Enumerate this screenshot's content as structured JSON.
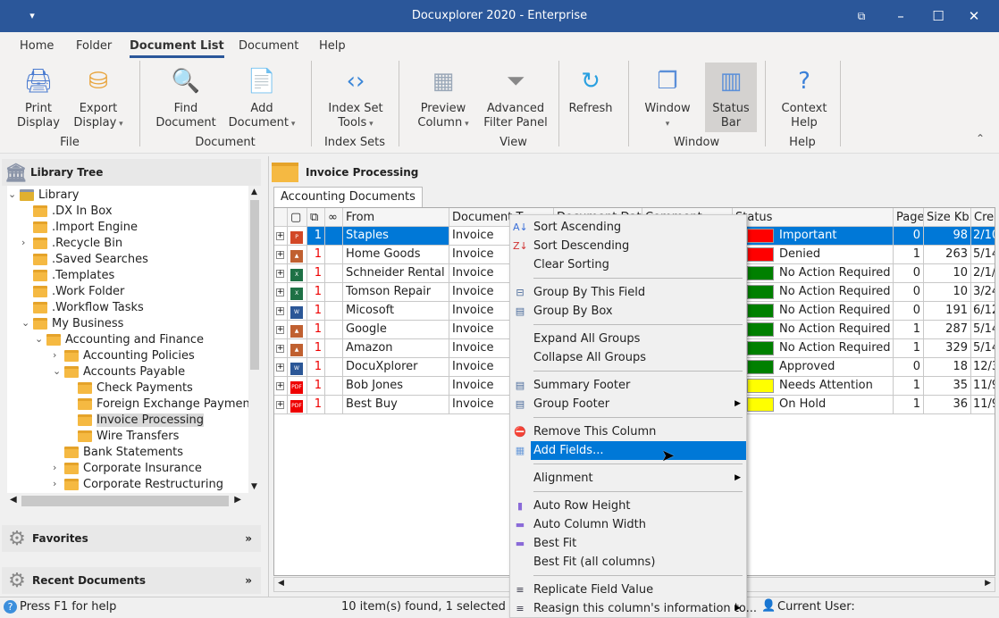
{
  "window": {
    "title": "Docuxplorer 2020 - Enterprise",
    "controls": [
      "restore-panel",
      "minimize",
      "maximize",
      "close"
    ]
  },
  "ribbon": {
    "tabs": [
      "Home",
      "Folder",
      "Document List",
      "Document",
      "Help"
    ],
    "active_tab": "Document List",
    "buttons": [
      {
        "l1": "Print",
        "l2": "Display",
        "icon": "printer-icon"
      },
      {
        "l1": "Export",
        "l2": "Display",
        "icon": "export-database-icon",
        "dropdown": true
      },
      {
        "l1": "Find",
        "l2": "Document",
        "icon": "magnifier-icon"
      },
      {
        "l1": "Add",
        "l2": "Document",
        "icon": "add-document-icon",
        "dropdown": true
      },
      {
        "l1": "Index Set",
        "l2": "Tools",
        "icon": "code-icon",
        "dropdown": true
      },
      {
        "l1": "Preview",
        "l2": "Column",
        "icon": "table-icon",
        "dropdown": true
      },
      {
        "l1": "Advanced",
        "l2": "Filter Panel",
        "icon": "funnel-icon"
      },
      {
        "l1": "Refresh",
        "l2": "",
        "icon": "refresh-icon"
      },
      {
        "l1": "Window",
        "l2": "",
        "icon": "windows-icon",
        "dropdown": true
      },
      {
        "l1": "Status",
        "l2": "Bar",
        "icon": "status-bar-icon",
        "pressed": true
      },
      {
        "l1": "Context",
        "l2": "Help",
        "icon": "help-icon"
      }
    ],
    "groups": [
      "File",
      "Document",
      "Index Sets",
      "View",
      "Window",
      "Help"
    ]
  },
  "left": {
    "library_tree_title": "Library Tree",
    "tree": [
      {
        "label": "Library",
        "level": 0,
        "expanded": true
      },
      {
        "label": ".DX In Box",
        "level": 1
      },
      {
        "label": ".Import Engine",
        "level": 1
      },
      {
        "label": ".Recycle Bin",
        "level": 1,
        "collapsed": true
      },
      {
        "label": ".Saved Searches",
        "level": 1
      },
      {
        "label": ".Templates",
        "level": 1
      },
      {
        "label": ".Work Folder",
        "level": 1
      },
      {
        "label": ".Workflow Tasks",
        "level": 1
      },
      {
        "label": "My Business",
        "level": 1,
        "expanded": true
      },
      {
        "label": "Accounting and Finance",
        "level": 2,
        "expanded": true
      },
      {
        "label": "Accounting Policies",
        "level": 3,
        "collapsed": true
      },
      {
        "label": "Accounts Payable",
        "level": 3,
        "expanded": true
      },
      {
        "label": "Check Payments",
        "level": 4
      },
      {
        "label": "Foreign Exchange Payment",
        "level": 4
      },
      {
        "label": "Invoice Processing",
        "level": 4,
        "selected": true
      },
      {
        "label": "Wire Transfers",
        "level": 4
      },
      {
        "label": "Bank Statements",
        "level": 3
      },
      {
        "label": "Corporate Insurance",
        "level": 3,
        "collapsed": true
      },
      {
        "label": "Corporate Restructuring",
        "level": 3,
        "collapsed": true
      }
    ],
    "favorites": "Favorites",
    "recent": "Recent Documents"
  },
  "main": {
    "folder_title": "Invoice Processing",
    "tab": "Accounting Documents",
    "columns": [
      "From",
      "Document T",
      "Document Dat",
      "Comment",
      "Status",
      "Page",
      "Size Kb",
      "Crea"
    ],
    "rows": [
      {
        "icon": "powerpoint",
        "count": "1",
        "from": "Staples",
        "type": "Invoice",
        "status": "Important",
        "color": "#ff0000",
        "pages": "0",
        "size": "98",
        "created": "2/10",
        "selected": true
      },
      {
        "icon": "image",
        "count": "1",
        "from": "Home Goods",
        "type": "Invoice",
        "status": "Denied",
        "color": "#ff0000",
        "pages": "1",
        "size": "263",
        "created": "5/14"
      },
      {
        "icon": "excel",
        "count": "1",
        "from": "Schneider Rental",
        "type": "Invoice",
        "status": "No Action Required",
        "color": "#008000",
        "pages": "0",
        "size": "10",
        "created": "2/1/"
      },
      {
        "icon": "excel",
        "count": "1",
        "from": "Tomson Repair",
        "type": "Invoice",
        "status": "No Action Required",
        "color": "#008000",
        "pages": "0",
        "size": "10",
        "created": "3/24"
      },
      {
        "icon": "word",
        "count": "1",
        "from": "Micosoft",
        "type": "Invoice",
        "status": "No Action Required",
        "color": "#008000",
        "pages": "0",
        "size": "191",
        "created": "6/12"
      },
      {
        "icon": "image",
        "count": "1",
        "from": "Google",
        "type": "Invoice",
        "status": "No Action Required",
        "color": "#008000",
        "pages": "1",
        "size": "287",
        "created": "5/14"
      },
      {
        "icon": "image",
        "count": "1",
        "from": "Amazon",
        "type": "Invoice",
        "status": "No Action Required",
        "color": "#008000",
        "pages": "1",
        "size": "329",
        "created": "5/14"
      },
      {
        "icon": "word",
        "count": "1",
        "from": "DocuXplorer",
        "type": "Invoice",
        "status": "Approved",
        "color": "#008000",
        "pages": "0",
        "size": "18",
        "created": "12/3"
      },
      {
        "icon": "pdf",
        "count": "1",
        "from": "Bob Jones",
        "type": "Invoice",
        "status": "Needs Attention",
        "color": "#ffff00",
        "pages": "1",
        "size": "35",
        "created": "11/9"
      },
      {
        "icon": "pdf",
        "count": "1",
        "from": "Best Buy",
        "type": "Invoice",
        "status": "On Hold",
        "color": "#ffff00",
        "pages": "1",
        "size": "36",
        "created": "11/9"
      }
    ]
  },
  "context_menu": [
    {
      "label": "Sort Ascending",
      "icon": "sort-ascending-icon"
    },
    {
      "label": "Sort Descending",
      "icon": "sort-descending-icon"
    },
    {
      "label": "Clear Sorting"
    },
    {
      "sep": true
    },
    {
      "label": "Group By This Field",
      "icon": "group-by-field-icon"
    },
    {
      "label": "Group By Box",
      "icon": "group-by-box-icon"
    },
    {
      "sep": true
    },
    {
      "label": "Expand All Groups"
    },
    {
      "label": "Collapse All Groups"
    },
    {
      "sep": true
    },
    {
      "label": "Summary Footer",
      "icon": "summary-footer-icon"
    },
    {
      "label": "Group Footer",
      "icon": "group-footer-icon",
      "submenu": true
    },
    {
      "sep": true
    },
    {
      "label": "Remove This Column",
      "icon": "remove-icon"
    },
    {
      "label": "Add Fields...",
      "icon": "add-fields-icon",
      "highlighted": true
    },
    {
      "sep": true
    },
    {
      "label": "Alignment",
      "submenu": true
    },
    {
      "sep": true
    },
    {
      "label": "Auto Row Height",
      "icon": "auto-row-height-icon"
    },
    {
      "label": "Auto Column Width",
      "icon": "auto-column-width-icon"
    },
    {
      "label": "Best Fit",
      "icon": "best-fit-icon"
    },
    {
      "label": "Best Fit (all columns)"
    },
    {
      "sep": true
    },
    {
      "label": "Replicate Field Value",
      "icon": "replicate-icon"
    },
    {
      "label": "Reasign this column's information to...",
      "icon": "reassign-icon",
      "submenu": true
    }
  ],
  "status": {
    "help": "Press F1 for help",
    "count": "10 item(s) found, 1 selected",
    "user": "Current User:"
  },
  "colors": {
    "titlebar": "#2b579a",
    "selection": "#0078d7"
  }
}
